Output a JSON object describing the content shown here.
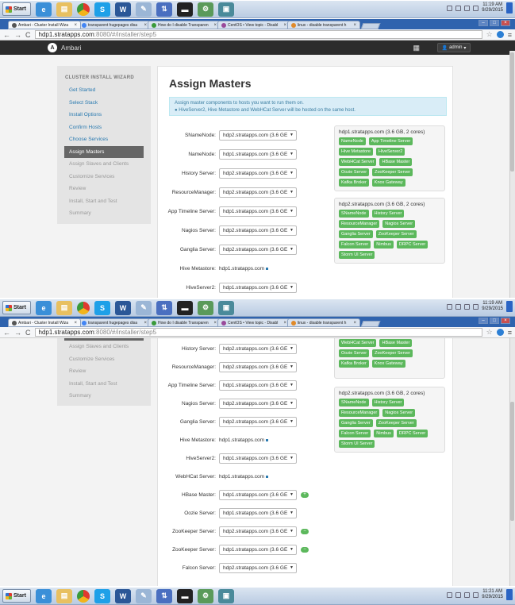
{
  "taskbar": {
    "start_label": "Start",
    "icons": [
      "ie-icon",
      "folder-icon",
      "chrome-icon",
      "skype-icon",
      "word-icon",
      "paint-icon",
      "transfer-icon",
      "terminal-icon",
      "network-icon",
      "remote-icon"
    ],
    "time_top": "11:19 AM",
    "date_top": "9/29/2015",
    "time_bottom": "11:21 AM",
    "date_bottom": "9/29/2015"
  },
  "browser": {
    "tabs": [
      {
        "title": "Ambari - Cluster Install Wiza"
      },
      {
        "title": "transparent hugepages disa"
      },
      {
        "title": "How do I disable Transparen"
      },
      {
        "title": "CentOS • View topic - Disabl"
      },
      {
        "title": "linux - disable transparent h"
      }
    ],
    "url_host": "hdp1.stratapps.com",
    "url_rest": ":8080/#/installer/step5"
  },
  "ambari": {
    "brand": "Ambari",
    "admin_label": "admin"
  },
  "sidebar": {
    "title": "CLUSTER INSTALL WIZARD",
    "items": [
      {
        "label": "Get Started"
      },
      {
        "label": "Select Stack"
      },
      {
        "label": "Install Options"
      },
      {
        "label": "Confirm Hosts"
      },
      {
        "label": "Choose Services"
      },
      {
        "label": "Assign Masters"
      },
      {
        "label": "Assign Slaves and Clients"
      },
      {
        "label": "Customize Services"
      },
      {
        "label": "Review"
      },
      {
        "label": "Install, Start and Test"
      },
      {
        "label": "Summary"
      }
    ]
  },
  "main": {
    "title": "Assign Masters",
    "info_line1": "Assign master components to hosts you want to run them on.",
    "info_line2": "HiveServer2, Hive Metastore and WebHCat Server will be hosted on the same host."
  },
  "form1": [
    {
      "label": "SNameNode:",
      "value": "hdp2.stratapps.com (3.6 GE"
    },
    {
      "label": "NameNode:",
      "value": "hdp1.stratapps.com (3.6 GE"
    },
    {
      "label": "History Server:",
      "value": "hdp2.stratapps.com (3.6 GE"
    },
    {
      "label": "ResourceManager:",
      "value": "hdp2.stratapps.com (3.6 GE"
    },
    {
      "label": "App Timeline Server:",
      "value": "hdp1.stratapps.com (3.6 GE"
    },
    {
      "label": "Nagios Server:",
      "value": "hdp2.stratapps.com (3.6 GE"
    },
    {
      "label": "Ganglia Server:",
      "value": "hdp2.stratapps.com (3.6 GE"
    },
    {
      "label": "Hive Metastore:",
      "text": "hdp1.stratapps.com"
    },
    {
      "label": "HiveServer2:",
      "value": "hdp1.stratapps.com (3.6 GE"
    }
  ],
  "form2": [
    {
      "label": "History Server:",
      "value": "hdp2.stratapps.com (3.6 GE"
    },
    {
      "label": "ResourceManager:",
      "value": "hdp2.stratapps.com (3.6 GE"
    },
    {
      "label": "App Timeline Server:",
      "value": "hdp1.stratapps.com (3.6 GE"
    },
    {
      "label": "Nagios Server:",
      "value": "hdp2.stratapps.com (3.6 GE"
    },
    {
      "label": "Ganglia Server:",
      "value": "hdp2.stratapps.com (3.6 GE"
    },
    {
      "label": "Hive Metastore:",
      "text": "hdp1.stratapps.com"
    },
    {
      "label": "HiveServer2:",
      "value": "hdp1.stratapps.com (3.6 GE"
    },
    {
      "label": "WebHCat Server:",
      "text": "hdp1.stratapps.com"
    },
    {
      "label": "HBase Master:",
      "value": "hdp1.stratapps.com (3.6 GE",
      "plus": true
    },
    {
      "label": "Oozie Server:",
      "value": "hdp1.stratapps.com (3.6 GE"
    },
    {
      "label": "ZooKeeper Server:",
      "value": "hdp2.stratapps.com (3.6 GE",
      "minus": true
    },
    {
      "label": "ZooKeeper Server:",
      "value": "hdp1.stratapps.com (3.6 GE",
      "minus": true
    },
    {
      "label": "Falcon Server:",
      "value": "hdp2.stratapps.com (3.6 GE"
    }
  ],
  "hosts": [
    {
      "name": "hdp1.stratapps.com (3.6 GB, 2 cores)",
      "components": [
        "NameNode",
        "App Timeline Server",
        "Hive Metastore",
        "HiveServer2",
        "WebHCat Server",
        "HBase Master",
        "Oozie Server",
        "ZooKeeper Server",
        "Kafka Broker",
        "Knox Gateway"
      ]
    },
    {
      "name": "hdp2.stratapps.com (3.6 GB, 2 cores)",
      "components": [
        "SNameNode",
        "History Server",
        "ResourceManager",
        "Nagios Server",
        "Ganglia Server",
        "ZooKeeper Server",
        "Falcon Server",
        "Nimbus",
        "DRPC Server",
        "Storm UI Server"
      ]
    }
  ],
  "colors": {
    "chip": "#5cb85c",
    "link": "#2a7ab0",
    "info_bg": "#d9edf7"
  }
}
